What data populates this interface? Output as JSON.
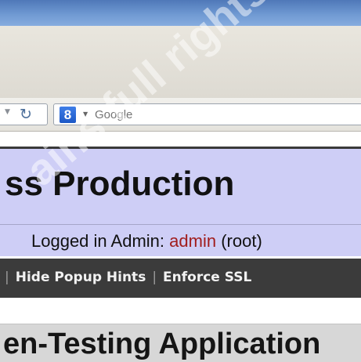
{
  "browser": {
    "search": {
      "engine_icon_letter": "8",
      "placeholder": "Google"
    },
    "reload_icon": "reload-icon"
  },
  "site": {
    "title": "ss Production",
    "login_label": "Logged in Admin:",
    "login_user": "admin",
    "login_role": "(root)"
  },
  "menu": {
    "items": [
      {
        "label": "Hide Popup Hints"
      },
      {
        "label": "Enforce SSL"
      }
    ],
    "separator": "|"
  },
  "section": {
    "heading": "en-Testing Application"
  },
  "watermark": "ains full rights."
}
